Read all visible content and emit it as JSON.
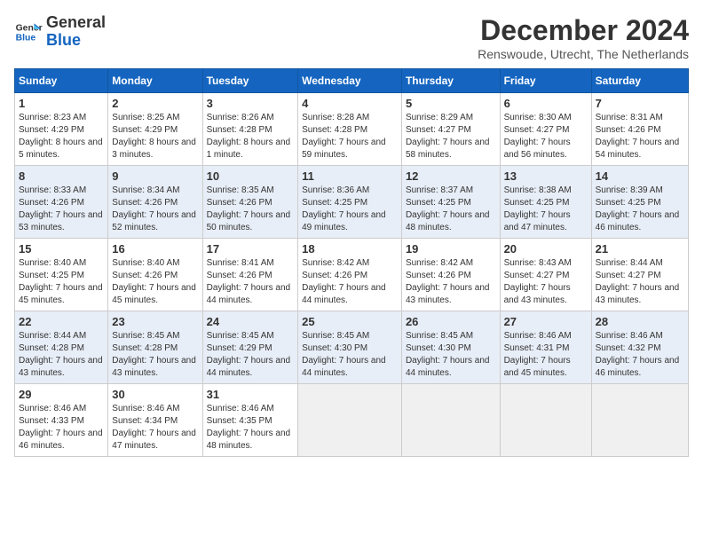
{
  "header": {
    "logo_line1": "General",
    "logo_line2": "Blue",
    "month_title": "December 2024",
    "location": "Renswoude, Utrecht, The Netherlands"
  },
  "days_of_week": [
    "Sunday",
    "Monday",
    "Tuesday",
    "Wednesday",
    "Thursday",
    "Friday",
    "Saturday"
  ],
  "weeks": [
    [
      {
        "day": "1",
        "sunrise": "8:23 AM",
        "sunset": "4:29 PM",
        "daylight": "8 hours and 5 minutes."
      },
      {
        "day": "2",
        "sunrise": "8:25 AM",
        "sunset": "4:29 PM",
        "daylight": "8 hours and 3 minutes."
      },
      {
        "day": "3",
        "sunrise": "8:26 AM",
        "sunset": "4:28 PM",
        "daylight": "8 hours and 1 minute."
      },
      {
        "day": "4",
        "sunrise": "8:28 AM",
        "sunset": "4:28 PM",
        "daylight": "7 hours and 59 minutes."
      },
      {
        "day": "5",
        "sunrise": "8:29 AM",
        "sunset": "4:27 PM",
        "daylight": "7 hours and 58 minutes."
      },
      {
        "day": "6",
        "sunrise": "8:30 AM",
        "sunset": "4:27 PM",
        "daylight": "7 hours and 56 minutes."
      },
      {
        "day": "7",
        "sunrise": "8:31 AM",
        "sunset": "4:26 PM",
        "daylight": "7 hours and 54 minutes."
      }
    ],
    [
      {
        "day": "8",
        "sunrise": "8:33 AM",
        "sunset": "4:26 PM",
        "daylight": "7 hours and 53 minutes."
      },
      {
        "day": "9",
        "sunrise": "8:34 AM",
        "sunset": "4:26 PM",
        "daylight": "7 hours and 52 minutes."
      },
      {
        "day": "10",
        "sunrise": "8:35 AM",
        "sunset": "4:26 PM",
        "daylight": "7 hours and 50 minutes."
      },
      {
        "day": "11",
        "sunrise": "8:36 AM",
        "sunset": "4:25 PM",
        "daylight": "7 hours and 49 minutes."
      },
      {
        "day": "12",
        "sunrise": "8:37 AM",
        "sunset": "4:25 PM",
        "daylight": "7 hours and 48 minutes."
      },
      {
        "day": "13",
        "sunrise": "8:38 AM",
        "sunset": "4:25 PM",
        "daylight": "7 hours and 47 minutes."
      },
      {
        "day": "14",
        "sunrise": "8:39 AM",
        "sunset": "4:25 PM",
        "daylight": "7 hours and 46 minutes."
      }
    ],
    [
      {
        "day": "15",
        "sunrise": "8:40 AM",
        "sunset": "4:25 PM",
        "daylight": "7 hours and 45 minutes."
      },
      {
        "day": "16",
        "sunrise": "8:40 AM",
        "sunset": "4:26 PM",
        "daylight": "7 hours and 45 minutes."
      },
      {
        "day": "17",
        "sunrise": "8:41 AM",
        "sunset": "4:26 PM",
        "daylight": "7 hours and 44 minutes."
      },
      {
        "day": "18",
        "sunrise": "8:42 AM",
        "sunset": "4:26 PM",
        "daylight": "7 hours and 44 minutes."
      },
      {
        "day": "19",
        "sunrise": "8:42 AM",
        "sunset": "4:26 PM",
        "daylight": "7 hours and 43 minutes."
      },
      {
        "day": "20",
        "sunrise": "8:43 AM",
        "sunset": "4:27 PM",
        "daylight": "7 hours and 43 minutes."
      },
      {
        "day": "21",
        "sunrise": "8:44 AM",
        "sunset": "4:27 PM",
        "daylight": "7 hours and 43 minutes."
      }
    ],
    [
      {
        "day": "22",
        "sunrise": "8:44 AM",
        "sunset": "4:28 PM",
        "daylight": "7 hours and 43 minutes."
      },
      {
        "day": "23",
        "sunrise": "8:45 AM",
        "sunset": "4:28 PM",
        "daylight": "7 hours and 43 minutes."
      },
      {
        "day": "24",
        "sunrise": "8:45 AM",
        "sunset": "4:29 PM",
        "daylight": "7 hours and 44 minutes."
      },
      {
        "day": "25",
        "sunrise": "8:45 AM",
        "sunset": "4:30 PM",
        "daylight": "7 hours and 44 minutes."
      },
      {
        "day": "26",
        "sunrise": "8:45 AM",
        "sunset": "4:30 PM",
        "daylight": "7 hours and 44 minutes."
      },
      {
        "day": "27",
        "sunrise": "8:46 AM",
        "sunset": "4:31 PM",
        "daylight": "7 hours and 45 minutes."
      },
      {
        "day": "28",
        "sunrise": "8:46 AM",
        "sunset": "4:32 PM",
        "daylight": "7 hours and 46 minutes."
      }
    ],
    [
      {
        "day": "29",
        "sunrise": "8:46 AM",
        "sunset": "4:33 PM",
        "daylight": "7 hours and 46 minutes."
      },
      {
        "day": "30",
        "sunrise": "8:46 AM",
        "sunset": "4:34 PM",
        "daylight": "7 hours and 47 minutes."
      },
      {
        "day": "31",
        "sunrise": "8:46 AM",
        "sunset": "4:35 PM",
        "daylight": "7 hours and 48 minutes."
      },
      null,
      null,
      null,
      null
    ]
  ]
}
